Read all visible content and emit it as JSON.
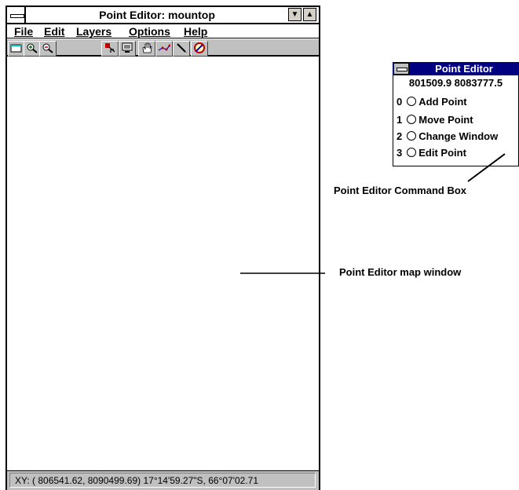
{
  "main_window": {
    "title": "Point Editor: mountop",
    "menus": [
      "File",
      "Edit",
      "Layers",
      "Options",
      "Help"
    ],
    "toolbar_icons": [
      "new-map-icon",
      "zoom-in-icon",
      "zoom-out-icon",
      "select-point-icon",
      "display-icon",
      "pan-hand-icon",
      "connect-points-icon",
      "pen-icon",
      "no-entry-icon"
    ],
    "status_text": "XY: ( 806541.62, 8090499.69) 17°14'59.27\"S, 66°07'02.71"
  },
  "command_box": {
    "title": "Point Editor",
    "coords": "801509.9  8083777.5",
    "options": [
      {
        "key": "0",
        "label": "Add Point"
      },
      {
        "key": "1",
        "label": "Move Point"
      },
      {
        "key": "2",
        "label": "Change Window"
      },
      {
        "key": "3",
        "label": "Edit Point"
      }
    ]
  },
  "captions": {
    "command_box": "Point Editor Command Box",
    "map_window": "Point Editor map window"
  }
}
